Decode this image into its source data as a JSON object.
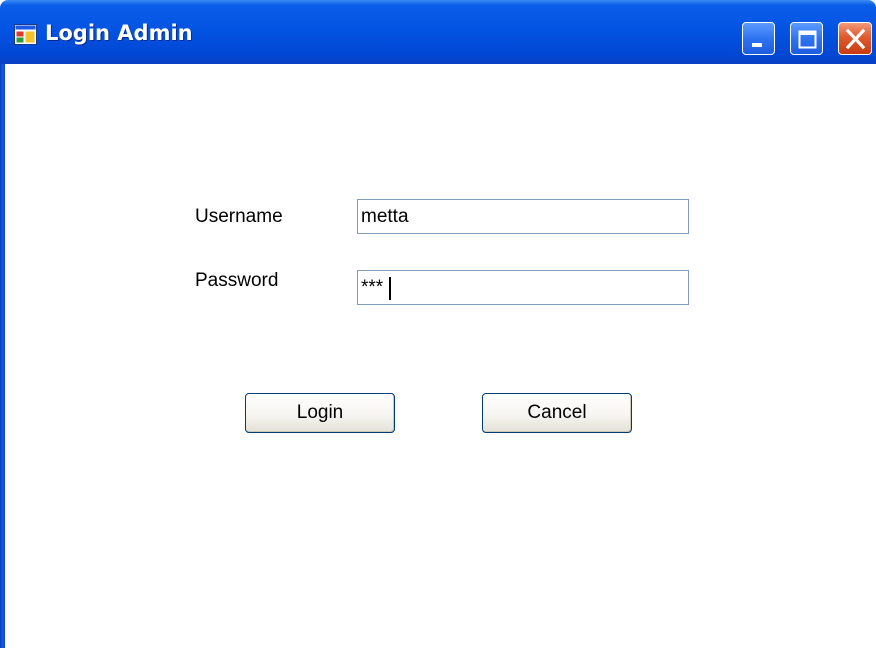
{
  "window": {
    "title": "Login Admin",
    "icon": "app-window-icon",
    "controls": {
      "minimize_icon": "minimize-icon",
      "maximize_icon": "maximize-icon",
      "close_icon": "close-icon"
    }
  },
  "form": {
    "username_label": "Username",
    "username_value": "metta",
    "password_label": "Password",
    "password_value": "***"
  },
  "buttons": {
    "login_label": "Login",
    "cancel_label": "Cancel"
  },
  "colors": {
    "titlebar": "#0454e3",
    "close_button": "#e05a2f",
    "textbox_border": "#7f9db9",
    "button_border": "#003c74"
  }
}
